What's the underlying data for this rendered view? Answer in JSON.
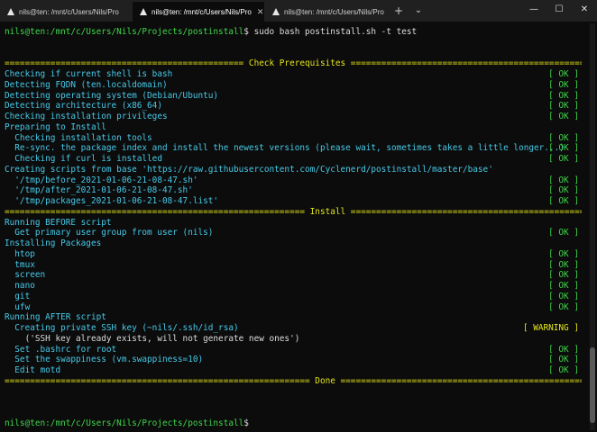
{
  "tabs": [
    {
      "label": "nils@ten: /mnt/c/Users/Nils/Pro"
    },
    {
      "label": "nils@ten: /mnt/c/Users/Nils/Pro"
    },
    {
      "label": "nils@ten: /mnt/c/Users/Nils/Pro"
    }
  ],
  "toolbar": {
    "new_tab": "+",
    "dropdown": "⌄"
  },
  "window": {
    "minimize": "—",
    "maximize": "☐",
    "close": "✕"
  },
  "prompt": {
    "user": "nils@ten",
    "path": ":/mnt/c/Users/Nils/Projects/postinstall",
    "symbol": "$",
    "command": " sudo bash postinstall.sh -t test"
  },
  "sections": {
    "prereq": "=============================================== Check Prerequisites ================================================",
    "install": "=========================================================== Install ===========================================================",
    "done": "============================================================ Done ============================================================"
  },
  "lines": {
    "l1": "Checking if current shell is bash",
    "l2": "Detecting FQDN (ten.localdomain)",
    "l3": "Detecting operating system (Debian/Ubuntu)",
    "l4": "Detecting architecture (x86_64)",
    "l5": "Checking installation privileges",
    "l6": "Preparing to Install",
    "l7": "  Checking installation tools",
    "l8": "  Re-sync. the package index and install the newest versions (please wait, sometimes takes a little longer...)",
    "l9": "  Checking if curl is installed",
    "l10": "Creating scripts from base 'https://raw.githubusercontent.com/Cyclenerd/postinstall/master/base'",
    "l11": "  '/tmp/before_2021-01-06-21-08-47.sh'",
    "l12": "  '/tmp/after_2021-01-06-21-08-47.sh'",
    "l13": "  '/tmp/packages_2021-01-06-21-08-47.list'",
    "l14": "Running BEFORE script",
    "l15": "  Get primary user group from user (nils)",
    "l16": "Installing Packages",
    "l17": "  htop",
    "l18": "  tmux",
    "l19": "  screen",
    "l20": "  nano",
    "l21": "  git",
    "l22": "  ufw",
    "l23": "Running AFTER script",
    "l24": "  Creating private SSH key (~nils/.ssh/id_rsa)",
    "l25": "    ('SSH key already exists, will not generate new ones')",
    "l26": "  Set .bashrc for root",
    "l27": "  Set the swappiness (vm.swappiness=10)",
    "l28": "  Edit motd"
  },
  "status": {
    "ok": "[ OK ]",
    "warning": "[ WARNING ]"
  },
  "colors": {
    "background": "#0c0c0c",
    "green": "#3fd64b",
    "cyan": "#47c9e8",
    "yellow": "#e5e51a",
    "text": "#dcdcdc"
  }
}
